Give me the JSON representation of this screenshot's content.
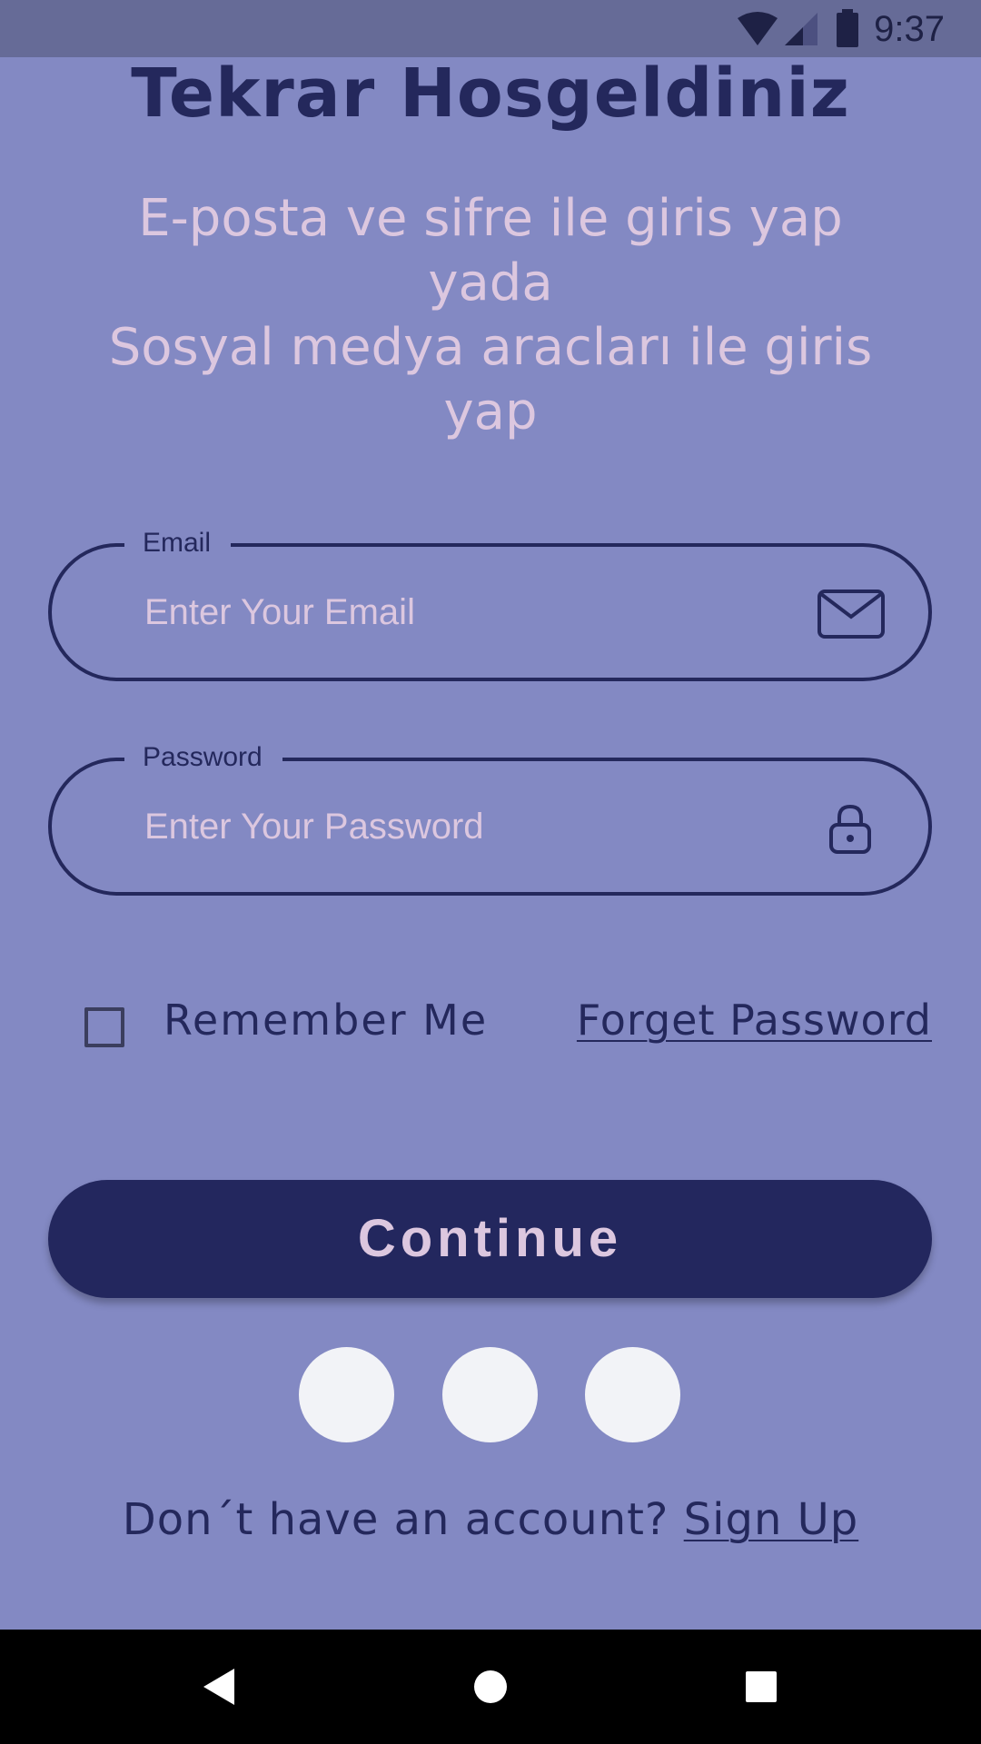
{
  "status_bar": {
    "time": "9:37",
    "icons": [
      "wifi-icon",
      "cell-signal-icon",
      "battery-icon"
    ]
  },
  "header": {
    "title": "Tekrar Hosgeldiniz",
    "subtitle": "E-posta ve sifre ile giris yap\nyada\nSosyal medya aracları ile giris\nyap"
  },
  "form": {
    "email": {
      "label": "Email",
      "placeholder": "Enter Your Email",
      "value": "",
      "icon": "envelope-icon"
    },
    "password": {
      "label": "Password",
      "placeholder": "Enter Your Password",
      "value": "",
      "icon": "lock-icon"
    },
    "remember_me": {
      "label": "Remember Me",
      "checked": false
    },
    "forget_password": "Forget Password",
    "continue_label": "Continue"
  },
  "social_buttons": [
    "social-login-button",
    "social-login-button",
    "social-login-button"
  ],
  "footer": {
    "prompt": "Don´t have an account? ",
    "sign_up": "Sign Up"
  },
  "navigation": {
    "icons": [
      "back-icon",
      "home-icon",
      "recents-icon"
    ]
  },
  "colors": {
    "background": "#8389c3",
    "status_bar": "#666b97",
    "primary": "#24285c",
    "accent_text": "#dcc7df",
    "social_button": "#f2f3f7"
  }
}
